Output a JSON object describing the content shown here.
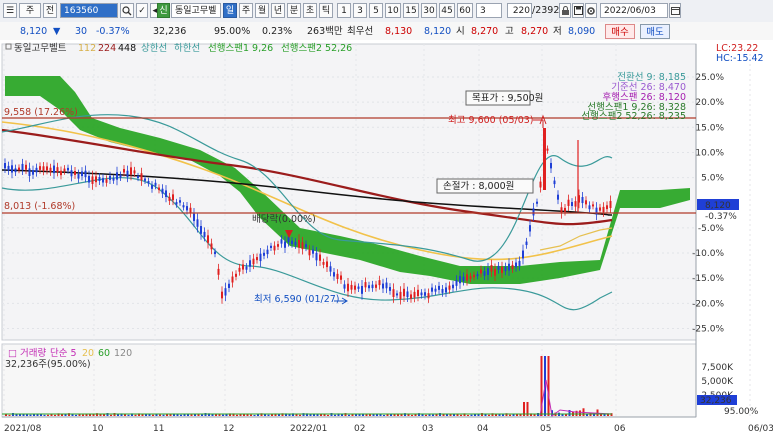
{
  "toolbar": {
    "menu_glyph": "☰",
    "type_label": "주",
    "jeon_label": "전",
    "stock_code": "163560",
    "search_icon": "search-icon",
    "check_label": "✓",
    "arrow_left": "◀",
    "shin_label": "신",
    "stock_name": "동일고무벨",
    "periods": [
      "일",
      "주",
      "월",
      "년",
      "분",
      "초",
      "틱"
    ],
    "active_period": "일",
    "intervals": [
      "1",
      "3",
      "5",
      "10",
      "15",
      "30",
      "45",
      "60"
    ],
    "interval_value": "3",
    "count_value": "220",
    "count_total": "/2392",
    "date_value": "2022/06/03"
  },
  "info": {
    "price": "8,120",
    "arrow": "▼",
    "change": "30",
    "change_pct": "-0.37%",
    "volume": "32,236",
    "vol_ratio": "95.00%",
    "turnover": "0.23%",
    "amount": "263백만",
    "min_label": "최우선",
    "ask": "8,130",
    "bid": "8,120",
    "open_label": "시",
    "open": "8,270",
    "high_label": "고",
    "high": "8,270",
    "low_label": "저",
    "low": "8,090",
    "buy_label": "매수",
    "sell_label": "매도"
  },
  "legend": {
    "name": "동일고무벨트",
    "ma1": "112",
    "ma2": "224",
    "ma3": "448",
    "upper": "상한선",
    "lower": "하한선",
    "span1": "선행스팬1 9,26",
    "span2": "선행스팬2 52,26",
    "lc": "LC:23.22",
    "hc": "HC:-15.42"
  },
  "ichimoku_labels": {
    "tenkan": "전환선 9: 8,185",
    "kijun": "기준선 26: 8,470",
    "chikou": "후행스팬 26: 8,120",
    "span1": "선행스팬1 9,26: 8,328",
    "span2": "선행스팬2 52,26: 8,235"
  },
  "annotations": {
    "target": "목표가  :  9,500원",
    "stoploss": "손절가  :  8,000원",
    "high": "최고 9,600 (05/03)",
    "low": "최저 6,590 (01/27)",
    "dividend": "배당락(0.00%)",
    "left_9558": "9,558 (17.26%)",
    "left_8013": "8,013 (-1.68%)"
  },
  "price_axis": [
    "25.0%",
    "20.0%",
    "15.0%",
    "10.0%",
    "5.0%",
    "-5.0%",
    "-10.0%",
    "-15.0%",
    "-20.0%",
    "-25.0%"
  ],
  "price_tag": "8,120",
  "price_tag_pct": "-0.37%",
  "volume_legend": {
    "label": "거래량",
    "sma": "단순 5",
    "p20": "20",
    "p60": "60",
    "p120": "120",
    "current": "32,236주(95.00%)"
  },
  "volume_axis": [
    "7,500K",
    "5,000K",
    "2,500K"
  ],
  "volume_tag": "32,236",
  "volume_tag_pct": "95.00%",
  "date_axis": [
    "2021/08",
    "10",
    "11",
    "12",
    "2022/01",
    "02",
    "03",
    "04",
    "05",
    "06",
    "06/03"
  ],
  "colors": {
    "cloud": "#22a31e",
    "bollinger": "#3a9a9a",
    "ma112": "#f2c24a",
    "ma224": "#9b1c1c",
    "ma448": "#111111",
    "up": "#e02020",
    "down": "#1f3fd6",
    "level": "#b03a2a"
  }
}
